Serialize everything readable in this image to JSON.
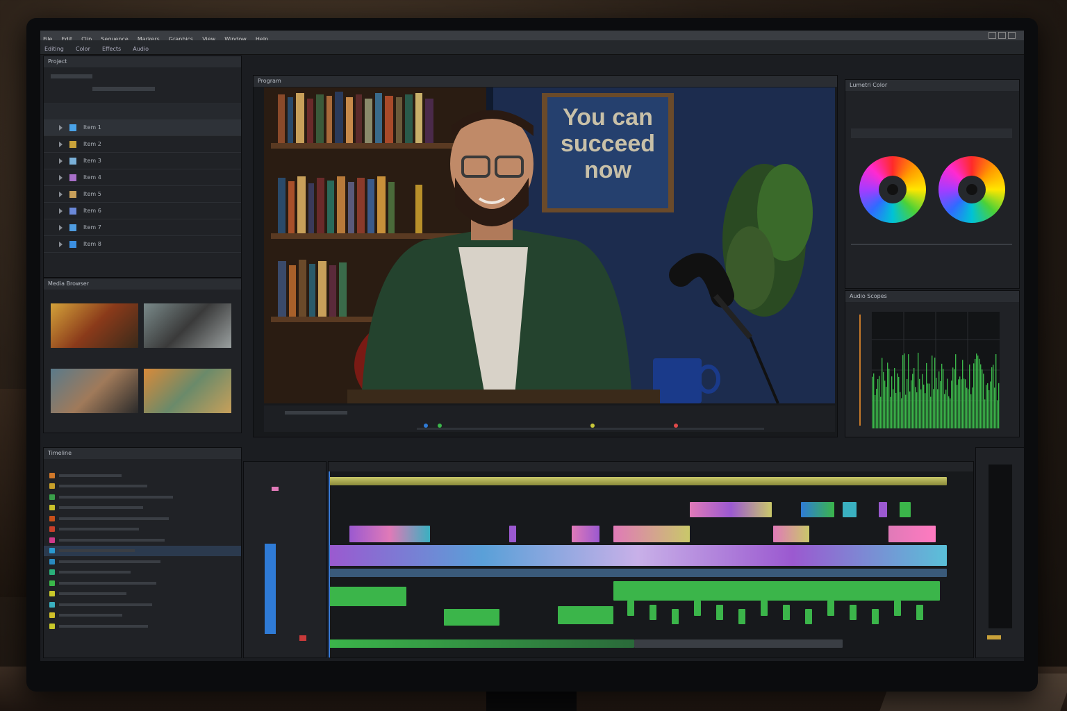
{
  "app": {
    "menu": [
      "File",
      "Edit",
      "Clip",
      "Sequence",
      "Markers",
      "Graphics",
      "View",
      "Window",
      "Help"
    ],
    "workspace_tabs": [
      "Editing",
      "Color",
      "Effects",
      "Audio"
    ]
  },
  "viewer": {
    "poster_text": "You can succeed now",
    "panel_title": "Program"
  },
  "project": {
    "title": "Project",
    "items": [
      "Item 1",
      "Item 2",
      "Item 3",
      "Item 4",
      "Item 5",
      "Item 6",
      "Item 7",
      "Item 8"
    ]
  },
  "media_browser": {
    "title": "Media Browser"
  },
  "color": {
    "title": "Lumetri Color"
  },
  "scopes": {
    "title": "Audio Scopes"
  },
  "timeline": {
    "title": "Timeline"
  },
  "colors": {
    "accent_blue": "#2f7bd6",
    "clip_green": "#3bb54a",
    "clip_purple": "#9b59d0",
    "clip_yellow": "#c9c86a",
    "clip_pink": "#e07ab8"
  }
}
